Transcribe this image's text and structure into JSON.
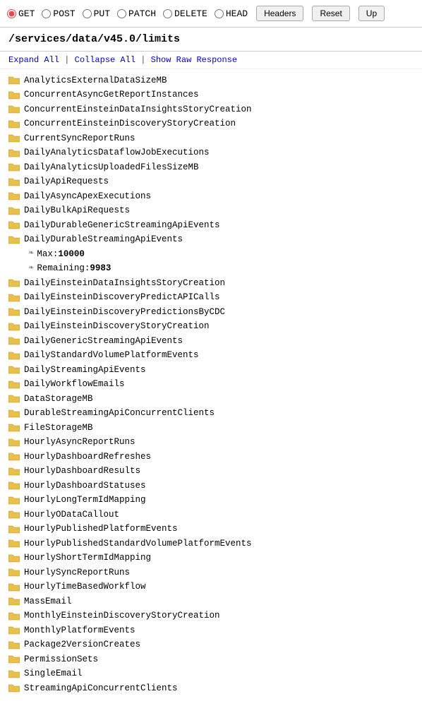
{
  "methods": [
    {
      "label": "GET",
      "value": "GET",
      "selected": true
    },
    {
      "label": "POST",
      "value": "POST",
      "selected": false
    },
    {
      "label": "PUT",
      "value": "PUT",
      "selected": false
    },
    {
      "label": "PATCH",
      "value": "PATCH",
      "selected": false
    },
    {
      "label": "DELETE",
      "value": "DELETE",
      "selected": false
    },
    {
      "label": "HEAD",
      "value": "HEAD",
      "selected": false
    }
  ],
  "buttons": {
    "headers": "Headers",
    "reset": "Reset",
    "up": "Up"
  },
  "url": "/services/data/v45.0/limits",
  "actions": {
    "expand_all": "Expand All",
    "collapse_all": "Collapse All",
    "show_raw": "Show Raw Response"
  },
  "tree_items": [
    {
      "label": "AnalyticsExternalDataSizeMB",
      "type": "folder"
    },
    {
      "label": "ConcurrentAsyncGetReportInstances",
      "type": "folder"
    },
    {
      "label": "ConcurrentEinsteinDataInsightsStoryCreation",
      "type": "folder"
    },
    {
      "label": "ConcurrentEinsteinDiscoveryStoryCreation",
      "type": "folder"
    },
    {
      "label": "CurrentSyncReportRuns",
      "type": "folder"
    },
    {
      "label": "DailyAnalyticsDataflowJobExecutions",
      "type": "folder"
    },
    {
      "label": "DailyAnalyticsUploadedFilesSizeMB",
      "type": "folder"
    },
    {
      "label": "DailyApiRequests",
      "type": "folder"
    },
    {
      "label": "DailyAsyncApexExecutions",
      "type": "folder"
    },
    {
      "label": "DailyBulkApiRequests",
      "type": "folder"
    },
    {
      "label": "DailyDurableGenericStreamingApiEvents",
      "type": "folder"
    },
    {
      "label": "DailyDurableStreamingApiEvents",
      "type": "folder-expanded",
      "children": [
        {
          "key": "Max:",
          "value": "10000"
        },
        {
          "key": "Remaining:",
          "value": "9983"
        }
      ]
    },
    {
      "label": "DailyEinsteinDataInsightsStoryCreation",
      "type": "folder"
    },
    {
      "label": "DailyEinsteinDiscoveryPredictAPICalls",
      "type": "folder"
    },
    {
      "label": "DailyEinsteinDiscoveryPredictionsByCDC",
      "type": "folder"
    },
    {
      "label": "DailyEinsteinDiscoveryStoryCreation",
      "type": "folder"
    },
    {
      "label": "DailyGenericStreamingApiEvents",
      "type": "folder"
    },
    {
      "label": "DailyStandardVolumePlatformEvents",
      "type": "folder"
    },
    {
      "label": "DailyStreamingApiEvents",
      "type": "folder"
    },
    {
      "label": "DailyWorkflowEmails",
      "type": "folder"
    },
    {
      "label": "DataStorageMB",
      "type": "folder"
    },
    {
      "label": "DurableStreamingApiConcurrentClients",
      "type": "folder"
    },
    {
      "label": "FileStorageMB",
      "type": "folder"
    },
    {
      "label": "HourlyAsyncReportRuns",
      "type": "folder"
    },
    {
      "label": "HourlyDashboardRefreshes",
      "type": "folder"
    },
    {
      "label": "HourlyDashboardResults",
      "type": "folder"
    },
    {
      "label": "HourlyDashboardStatuses",
      "type": "folder"
    },
    {
      "label": "HourlyLongTermIdMapping",
      "type": "folder"
    },
    {
      "label": "HourlyODataCallout",
      "type": "folder"
    },
    {
      "label": "HourlyPublishedPlatformEvents",
      "type": "folder"
    },
    {
      "label": "HourlyPublishedStandardVolumePlatformEvents",
      "type": "folder"
    },
    {
      "label": "HourlyShortTermIdMapping",
      "type": "folder"
    },
    {
      "label": "HourlySyncReportRuns",
      "type": "folder"
    },
    {
      "label": "HourlyTimeBasedWorkflow",
      "type": "folder"
    },
    {
      "label": "MassEmail",
      "type": "folder"
    },
    {
      "label": "MonthlyEinsteinDiscoveryStoryCreation",
      "type": "folder"
    },
    {
      "label": "MonthlyPlatformEvents",
      "type": "folder"
    },
    {
      "label": "Package2VersionCreates",
      "type": "folder"
    },
    {
      "label": "PermissionSets",
      "type": "folder"
    },
    {
      "label": "SingleEmail",
      "type": "folder"
    },
    {
      "label": "StreamingApiConcurrentClients",
      "type": "folder"
    }
  ]
}
